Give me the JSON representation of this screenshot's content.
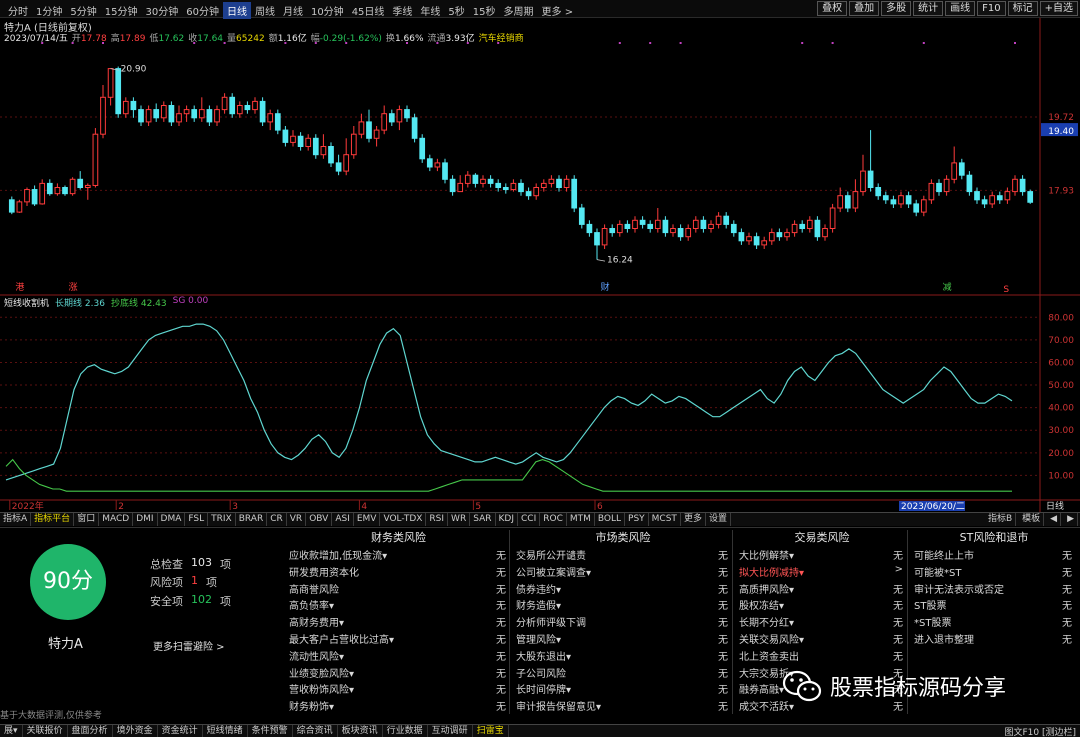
{
  "toolbar": {
    "periods": [
      "分时",
      "1分钟",
      "5分钟",
      "15分钟",
      "30分钟",
      "60分钟",
      "日线",
      "周线",
      "月线",
      "10分钟",
      "45日线",
      "季线",
      "年线",
      "5秒",
      "15秒",
      "多周期",
      "更多 >"
    ],
    "active_period": "日线",
    "right_tools": [
      "叠权",
      "叠加",
      "多股",
      "统计",
      "画线",
      "F10",
      "标记",
      "+自选"
    ]
  },
  "stock": {
    "title": "特力A (日线前复权)",
    "date": "2023/07/14/五",
    "open_label": "开",
    "open": "17.78",
    "high_label": "高",
    "high": "17.89",
    "low_label": "低",
    "low": "17.62",
    "close_label": "收",
    "close": "17.64",
    "vol_label": "量",
    "vol": "65242",
    "amount_label": "额",
    "amount": "1.16亿",
    "change_label": "幅",
    "change": "-0.29(-1.62%)",
    "turnover_label": "换",
    "turnover": "1.66%",
    "float_label": "流通",
    "float_cap": "3.93亿",
    "sector": "汽车经销商"
  },
  "price_axis": {
    "top_label": "19.72",
    "current_label": "19.40",
    "low_label": "17.93"
  },
  "annotations": {
    "high_point": "20.90",
    "low_point": "16.24",
    "marker_left1": "港",
    "marker_left2": "涨",
    "marker_cai": "财",
    "marker_jian": "减",
    "marker_s": "S"
  },
  "indicator": {
    "name": "短线收割机",
    "long_label": "长期线",
    "long_value": "2.36",
    "bottom_label": "抄底线",
    "bottom_value": "42.43",
    "sg_label": "SG",
    "sg_value": "0.00",
    "axis_labels": [
      "80.00",
      "70.00",
      "60.00",
      "50.00",
      "40.00",
      "30.00",
      "20.00",
      "10.00"
    ]
  },
  "time_axis": {
    "labels": [
      "2022年",
      "2",
      "3",
      "4",
      "5",
      "6"
    ],
    "highlight": "2023/06/20/二",
    "right": "日线"
  },
  "tabs": [
    "指标A",
    "指标平台",
    "窗口",
    "MACD",
    "DMI",
    "DMA",
    "FSL",
    "TRIX",
    "BRAR",
    "CR",
    "VR",
    "OBV",
    "ASI",
    "EMV",
    "VOL-TDX",
    "RSI",
    "WR",
    "SAR",
    "KDJ",
    "CCI",
    "ROC",
    "MTM",
    "BOLL",
    "PSY",
    "MCST",
    "更多",
    "设置"
  ],
  "active_tab": "指标平台",
  "tabs_right": [
    "指标B",
    "模板",
    "◀",
    "▶"
  ],
  "risk": {
    "score": "90分",
    "company": "特力A",
    "total_label": "总检查",
    "total": "103",
    "unit": "项",
    "risk_label": "风险项",
    "risk": "1",
    "safe_label": "安全项",
    "safe": "102",
    "more": "更多扫雷避险 >",
    "columns": [
      {
        "title": "财务类风险",
        "items": [
          {
            "label": "应收款增加,低现金流▾",
            "value": "无"
          },
          {
            "label": "研发费用资本化",
            "value": "无"
          },
          {
            "label": "高商誉风险",
            "value": "无"
          },
          {
            "label": "高负债率▾",
            "value": "无"
          },
          {
            "label": "高财务费用▾",
            "value": "无"
          },
          {
            "label": "最大客户占营收比过高▾",
            "value": "无"
          },
          {
            "label": "流动性风险▾",
            "value": "无"
          },
          {
            "label": "业绩变脸风险▾",
            "value": "无"
          },
          {
            "label": "营收粉饰风险▾",
            "value": "无"
          },
          {
            "label": "财务粉饰▾",
            "value": "无"
          }
        ]
      },
      {
        "title": "市场类风险",
        "items": [
          {
            "label": "交易所公开谴责",
            "value": "无"
          },
          {
            "label": "公司被立案调查▾",
            "value": "无"
          },
          {
            "label": "债券违约▾",
            "value": "无"
          },
          {
            "label": "财务造假▾",
            "value": "无"
          },
          {
            "label": "分析师评级下调",
            "value": "无"
          },
          {
            "label": "管理风险▾",
            "value": "无"
          },
          {
            "label": "大股东退出▾",
            "value": "无"
          },
          {
            "label": "子公司风险",
            "value": "无"
          },
          {
            "label": "长时间停牌▾",
            "value": "无"
          },
          {
            "label": "审计报告保留意见▾",
            "value": "无"
          }
        ]
      },
      {
        "title": "交易类风险",
        "items": [
          {
            "label": "大比例解禁▾",
            "value": "无"
          },
          {
            "label": "拟大比例减持▾",
            "value": ">",
            "highlight": true
          },
          {
            "label": "高质押风险▾",
            "value": "无"
          },
          {
            "label": "股权冻结▾",
            "value": "无"
          },
          {
            "label": "长期不分红▾",
            "value": "无"
          },
          {
            "label": "关联交易风险▾",
            "value": "无"
          },
          {
            "label": "北上资金卖出",
            "value": "无"
          },
          {
            "label": "大宗交易折▾",
            "value": "无"
          },
          {
            "label": "融券高融▾",
            "value": "无"
          },
          {
            "label": "成交不活跃▾",
            "value": "无"
          }
        ]
      },
      {
        "title": "ST风险和退市",
        "items": [
          {
            "label": "可能终止上市",
            "value": "无"
          },
          {
            "label": "可能被*ST",
            "value": "无"
          },
          {
            "label": "审计无法表示或否定",
            "value": "无"
          },
          {
            "label": "ST股票",
            "value": "无"
          },
          {
            "label": "*ST股票",
            "value": "无"
          },
          {
            "label": "进入退市整理",
            "value": "无"
          }
        ]
      }
    ],
    "disclaimer": "基于大数据评测,仅供参考"
  },
  "watermark": "股票指标源码分享",
  "status_tabs": [
    "展▾",
    "关联报价",
    "盘面分析",
    "境外资金",
    "资金统计",
    "短线情绪",
    "条件预警",
    "综合资讯",
    "板块资讯",
    "行业数据",
    "互动调研",
    "扫雷宝"
  ],
  "active_status": "扫雷宝",
  "status_right": "图文F10  [测边栏]",
  "colors": {
    "up": "#ff3b3b",
    "down": "#54e8f2",
    "long_line": "#5fd6d0",
    "bottom_line": "#46c84a",
    "score": "#1fb56a"
  },
  "chart_data": {
    "type": "candlestick",
    "price_ylim": [
      15.5,
      21.5
    ],
    "candles": [
      [
        17.7,
        17.4,
        17.78,
        17.35
      ],
      [
        17.4,
        17.65,
        17.7,
        17.38
      ],
      [
        17.65,
        17.95,
        18.0,
        17.55
      ],
      [
        17.95,
        17.6,
        18.05,
        17.55
      ],
      [
        17.6,
        18.1,
        18.2,
        17.58
      ],
      [
        18.1,
        17.85,
        18.2,
        17.8
      ],
      [
        17.85,
        18.0,
        18.1,
        17.8
      ],
      [
        18.0,
        17.85,
        18.05,
        17.8
      ],
      [
        17.85,
        18.2,
        18.25,
        17.8
      ],
      [
        18.2,
        18.0,
        18.4,
        17.95
      ],
      [
        18.0,
        18.05,
        18.1,
        17.7
      ],
      [
        18.05,
        19.3,
        19.45,
        18.0
      ],
      [
        19.3,
        20.2,
        20.5,
        19.2
      ],
      [
        20.2,
        20.9,
        20.9,
        20.0
      ],
      [
        20.9,
        19.8,
        20.95,
        19.7
      ],
      [
        19.8,
        20.1,
        20.2,
        19.7
      ],
      [
        20.1,
        19.9,
        20.2,
        19.7
      ],
      [
        19.9,
        19.6,
        20.0,
        19.5
      ],
      [
        19.6,
        19.9,
        20.0,
        19.5
      ],
      [
        19.9,
        19.7,
        20.05,
        19.6
      ],
      [
        19.7,
        20.0,
        20.1,
        19.6
      ],
      [
        20.0,
        19.6,
        20.1,
        19.5
      ],
      [
        19.6,
        19.8,
        20.0,
        19.5
      ],
      [
        19.8,
        19.9,
        20.0,
        19.6
      ],
      [
        19.9,
        19.7,
        20.0,
        19.6
      ],
      [
        19.7,
        19.9,
        20.2,
        19.6
      ],
      [
        19.9,
        19.6,
        20.0,
        19.5
      ],
      [
        19.6,
        19.9,
        20.0,
        19.5
      ],
      [
        19.9,
        20.2,
        20.3,
        19.8
      ],
      [
        20.2,
        19.8,
        20.3,
        19.7
      ],
      [
        19.8,
        20.0,
        20.1,
        19.7
      ],
      [
        20.0,
        19.9,
        20.1,
        19.8
      ],
      [
        19.9,
        20.1,
        20.2,
        19.8
      ],
      [
        20.1,
        19.6,
        20.2,
        19.5
      ],
      [
        19.6,
        19.8,
        19.9,
        19.4
      ],
      [
        19.8,
        19.4,
        19.9,
        19.3
      ],
      [
        19.4,
        19.1,
        19.5,
        19.0
      ],
      [
        19.1,
        19.25,
        19.4,
        19.0
      ],
      [
        19.25,
        19.0,
        19.35,
        18.9
      ],
      [
        19.0,
        19.2,
        19.3,
        18.9
      ],
      [
        19.2,
        18.8,
        19.3,
        18.7
      ],
      [
        18.8,
        19.0,
        19.3,
        18.7
      ],
      [
        19.0,
        18.6,
        19.1,
        18.5
      ],
      [
        18.6,
        18.4,
        18.8,
        18.3
      ],
      [
        18.4,
        18.8,
        19.2,
        18.3
      ],
      [
        18.8,
        19.3,
        19.5,
        18.7
      ],
      [
        19.3,
        19.6,
        19.8,
        19.2
      ],
      [
        19.6,
        19.2,
        19.9,
        19.1
      ],
      [
        19.2,
        19.4,
        19.5,
        19.0
      ],
      [
        19.4,
        19.8,
        20.0,
        19.3
      ],
      [
        19.8,
        19.6,
        19.9,
        19.5
      ],
      [
        19.6,
        19.9,
        20.0,
        19.4
      ],
      [
        19.9,
        19.7,
        20.0,
        19.6
      ],
      [
        19.7,
        19.2,
        19.8,
        19.1
      ],
      [
        19.2,
        18.7,
        19.3,
        18.6
      ],
      [
        18.7,
        18.5,
        18.8,
        18.4
      ],
      [
        18.5,
        18.6,
        18.7,
        18.4
      ],
      [
        18.6,
        18.2,
        18.7,
        18.1
      ],
      [
        18.2,
        17.9,
        18.3,
        17.8
      ],
      [
        17.9,
        18.1,
        18.3,
        17.9
      ],
      [
        18.1,
        18.3,
        18.4,
        18.0
      ],
      [
        18.3,
        18.1,
        18.35,
        18.0
      ],
      [
        18.1,
        18.2,
        18.3,
        18.0
      ],
      [
        18.2,
        18.1,
        18.3,
        18.0
      ],
      [
        18.1,
        18.0,
        18.2,
        17.9
      ],
      [
        18.0,
        17.95,
        18.1,
        17.85
      ],
      [
        17.95,
        18.1,
        18.2,
        17.9
      ],
      [
        18.1,
        17.9,
        18.2,
        17.8
      ],
      [
        17.9,
        17.8,
        18.0,
        17.7
      ],
      [
        17.8,
        18.0,
        18.1,
        17.7
      ],
      [
        18.0,
        18.1,
        18.2,
        17.9
      ],
      [
        18.1,
        18.2,
        18.3,
        18.0
      ],
      [
        18.2,
        18.0,
        18.3,
        17.9
      ],
      [
        18.0,
        18.2,
        18.3,
        17.9
      ],
      [
        18.2,
        17.5,
        18.3,
        17.4
      ],
      [
        17.5,
        17.1,
        17.6,
        17.0
      ],
      [
        17.1,
        16.9,
        17.2,
        16.8
      ],
      [
        16.9,
        16.6,
        17.0,
        16.24
      ],
      [
        16.6,
        17.0,
        17.1,
        16.5
      ],
      [
        17.0,
        16.9,
        17.1,
        16.8
      ],
      [
        16.9,
        17.1,
        17.2,
        16.8
      ],
      [
        17.1,
        17.0,
        17.2,
        16.9
      ],
      [
        17.0,
        17.2,
        17.3,
        16.9
      ],
      [
        17.2,
        17.1,
        17.3,
        17.0
      ],
      [
        17.1,
        17.0,
        17.2,
        16.9
      ],
      [
        17.0,
        17.2,
        17.5,
        16.9
      ],
      [
        17.2,
        16.9,
        17.3,
        16.8
      ],
      [
        16.9,
        17.0,
        17.1,
        16.8
      ],
      [
        17.0,
        16.8,
        17.1,
        16.7
      ],
      [
        16.8,
        17.0,
        17.1,
        16.7
      ],
      [
        17.0,
        17.2,
        17.3,
        16.9
      ],
      [
        17.2,
        17.0,
        17.3,
        16.9
      ],
      [
        17.0,
        17.1,
        17.2,
        16.9
      ],
      [
        17.1,
        17.3,
        17.4,
        17.0
      ],
      [
        17.3,
        17.1,
        17.4,
        17.0
      ],
      [
        17.1,
        16.9,
        17.2,
        16.8
      ],
      [
        16.9,
        16.7,
        17.0,
        16.6
      ],
      [
        16.7,
        16.8,
        16.9,
        16.6
      ],
      [
        16.8,
        16.6,
        16.9,
        16.5
      ],
      [
        16.6,
        16.7,
        16.8,
        16.5
      ],
      [
        16.7,
        16.9,
        17.0,
        16.6
      ],
      [
        16.9,
        16.8,
        17.0,
        16.7
      ],
      [
        16.8,
        16.9,
        17.0,
        16.7
      ],
      [
        16.9,
        17.1,
        17.2,
        16.8
      ],
      [
        17.1,
        17.0,
        17.2,
        16.9
      ],
      [
        17.0,
        17.2,
        17.3,
        16.9
      ],
      [
        17.2,
        16.8,
        17.3,
        16.7
      ],
      [
        16.8,
        17.0,
        17.1,
        16.7
      ],
      [
        17.0,
        17.5,
        17.6,
        16.9
      ],
      [
        17.5,
        17.8,
        18.0,
        17.4
      ],
      [
        17.8,
        17.5,
        17.9,
        17.4
      ],
      [
        17.5,
        17.9,
        18.2,
        17.4
      ],
      [
        17.9,
        18.4,
        18.8,
        17.8
      ],
      [
        18.4,
        18.0,
        19.4,
        17.9
      ],
      [
        18.0,
        17.8,
        18.1,
        17.7
      ],
      [
        17.8,
        17.7,
        17.9,
        17.6
      ],
      [
        17.7,
        17.6,
        17.8,
        17.5
      ],
      [
        17.6,
        17.8,
        17.9,
        17.5
      ],
      [
        17.8,
        17.6,
        17.9,
        17.5
      ],
      [
        17.6,
        17.4,
        17.7,
        17.3
      ],
      [
        17.4,
        17.7,
        17.8,
        17.3
      ],
      [
        17.7,
        18.1,
        18.2,
        17.6
      ],
      [
        18.1,
        17.9,
        18.2,
        17.8
      ],
      [
        17.9,
        18.2,
        18.3,
        17.8
      ],
      [
        18.2,
        18.6,
        19.0,
        18.1
      ],
      [
        18.6,
        18.3,
        18.7,
        18.2
      ],
      [
        18.3,
        17.9,
        18.4,
        17.8
      ],
      [
        17.9,
        17.7,
        18.0,
        17.6
      ],
      [
        17.7,
        17.6,
        17.8,
        17.5
      ],
      [
        17.6,
        17.8,
        17.9,
        17.5
      ],
      [
        17.8,
        17.7,
        17.9,
        17.6
      ],
      [
        17.7,
        17.9,
        18.0,
        17.6
      ],
      [
        17.9,
        18.2,
        18.3,
        17.8
      ],
      [
        18.2,
        17.9,
        18.3,
        17.8
      ],
      [
        17.9,
        17.64,
        17.95,
        17.6
      ]
    ],
    "long_line": [
      8,
      9,
      10,
      11,
      12,
      13,
      14,
      15,
      22,
      35,
      48,
      55,
      58,
      59,
      57,
      56,
      55,
      56,
      58,
      62,
      66,
      70,
      72,
      73,
      74,
      75,
      76,
      76,
      77,
      77,
      76,
      74,
      70,
      64,
      58,
      52,
      44,
      38,
      30,
      24,
      20,
      18,
      17,
      19,
      22,
      26,
      28,
      25,
      20,
      18,
      22,
      30,
      40,
      52,
      60,
      68,
      73,
      75,
      72,
      60,
      48,
      36,
      28,
      24,
      21,
      20,
      19,
      18,
      17,
      16,
      16,
      17,
      18,
      17,
      16,
      15,
      16,
      18,
      20,
      18,
      17,
      16,
      17,
      20,
      24,
      28,
      32,
      36,
      40,
      43,
      45,
      44,
      42,
      41,
      43,
      46,
      44,
      42,
      43,
      45,
      44,
      42,
      40,
      38,
      36,
      36,
      38,
      40,
      42,
      44,
      46,
      48,
      44,
      42,
      46,
      52,
      56,
      58,
      54,
      52,
      56,
      60,
      63,
      64,
      66,
      64,
      60,
      56,
      52,
      48,
      46,
      44,
      42,
      44,
      46,
      48,
      52,
      55,
      58,
      56,
      52,
      48,
      44,
      42,
      42,
      44,
      46,
      45,
      43
    ],
    "bottom_line": [
      14,
      17,
      13,
      10,
      8,
      6,
      5,
      4,
      4,
      3,
      3,
      3,
      3,
      3,
      3,
      3,
      3,
      3,
      3,
      3,
      3,
      3,
      3,
      3,
      3,
      3,
      3,
      3,
      3,
      3,
      3,
      3,
      3,
      3,
      3,
      3,
      3,
      3,
      3,
      3,
      3,
      3,
      3,
      3,
      3,
      3,
      3,
      3,
      3,
      3,
      3,
      3,
      3,
      3,
      3,
      3,
      3,
      3,
      3,
      3,
      3,
      3,
      3,
      3,
      4,
      5,
      6,
      7,
      8,
      8,
      8,
      8,
      8,
      8,
      8,
      8,
      8,
      8,
      12,
      16,
      17,
      16,
      14,
      12,
      10,
      8,
      6,
      5,
      4,
      3,
      3,
      3,
      3,
      3,
      3,
      3,
      3,
      3,
      3,
      3,
      3,
      3,
      3,
      3,
      3,
      3,
      3,
      3,
      3,
      3,
      3,
      3,
      3,
      3,
      3,
      3,
      3,
      3,
      3,
      3,
      3,
      3,
      3,
      3,
      3,
      3,
      3,
      3,
      3,
      3,
      3,
      3,
      3,
      3,
      3,
      3,
      3,
      3,
      3,
      3,
      3,
      3,
      3,
      3,
      3,
      3,
      3,
      3,
      3,
      3,
      3
    ],
    "ind_ylim": [
      0,
      85
    ]
  }
}
